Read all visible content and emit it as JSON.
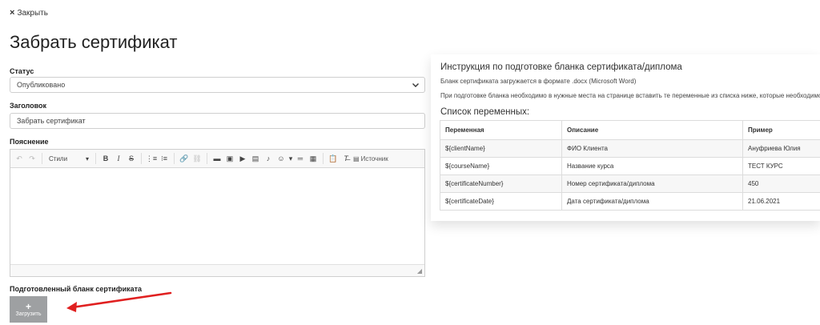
{
  "header": {
    "close_icon": "×",
    "close_label": "Закрыть",
    "page_title": "Забрать сертификат"
  },
  "form": {
    "status_label": "Статус",
    "status_value": "Опубликовано",
    "heading_label": "Заголовок",
    "heading_value": "Забрать сертификат",
    "explanation_label": "Пояснение",
    "editor_styles_label": "Стили",
    "editor_source_label": "Источник",
    "prepared_label": "Подготовленный бланк сертификата",
    "upload_plus": "+",
    "upload_label": "Загрузить"
  },
  "instructions": {
    "title": "Инструкция по подготовке бланка сертификата/диплома",
    "line1": "Бланк сертификата загружается в формате .docx (Microsoft Word)",
    "line2": "При подготовке бланка необходимо в нужные места на странице вставить те переменные из списка ниже, которые необходимо",
    "vars_title": "Список переменных:",
    "columns": [
      "Переменная",
      "Описание",
      "Пример"
    ],
    "rows": [
      [
        "${clientName}",
        "ФИО Клиента",
        "Ануфриева Юлия"
      ],
      [
        "${courseName}",
        "Название курса",
        "ТЕСТ КУРС"
      ],
      [
        "${certificateNumber}",
        "Номер сертификата/диплома",
        "450"
      ],
      [
        "${certificateDate}",
        "Дата сертификата/диплома",
        "21.06.2021"
      ]
    ]
  },
  "colors": {
    "annotation_arrow": "#e02020",
    "upload_button": "#9ea0a2"
  }
}
